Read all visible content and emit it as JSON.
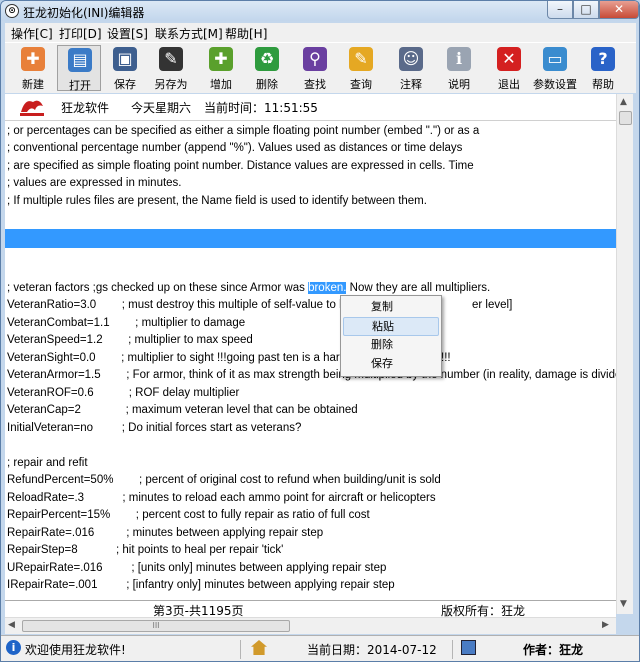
{
  "window": {
    "title": "狂龙初始化(INI)编辑器",
    "app_icon_glyph": "⊙",
    "controls": {
      "minimize": "–",
      "maximize": "□",
      "close": "✕"
    }
  },
  "menubar": {
    "items": [
      {
        "label": "操作[C]"
      },
      {
        "label": "打印[D]"
      },
      {
        "label": "设置[S]"
      },
      {
        "label": "联系方式[M]"
      },
      {
        "label": "帮助[H]"
      }
    ]
  },
  "toolbar": {
    "buttons": [
      {
        "label": "新建",
        "icon": "new-document-icon",
        "glyph": "✚",
        "color": "#e8803a"
      },
      {
        "label": "打开",
        "icon": "open-document-icon",
        "glyph": "▤",
        "color": "#3b7bc7"
      },
      {
        "label": "保存",
        "icon": "save-disk-icon",
        "glyph": "▣",
        "color": "#3e5f8f"
      },
      {
        "label": "另存为",
        "icon": "save-as-pen-icon",
        "glyph": "✎",
        "color": "#333333"
      },
      {
        "label": "增加",
        "icon": "add-icon",
        "glyph": "✚",
        "color": "#5aa02c"
      },
      {
        "label": "删除",
        "icon": "recycle-bin-icon",
        "glyph": "♻",
        "color": "#2e9b3e"
      },
      {
        "label": "查找",
        "icon": "magnifier-icon",
        "glyph": "⚲",
        "color": "#6a3fa0"
      },
      {
        "label": "查询",
        "icon": "query-icon",
        "glyph": "✎",
        "color": "#e5a823"
      },
      {
        "label": "注释",
        "icon": "people-icon",
        "glyph": "☺",
        "color": "#5a6a8a"
      },
      {
        "label": "说明",
        "icon": "person-info-icon",
        "glyph": "ℹ",
        "color": "#9aa4b2"
      },
      {
        "label": "退出",
        "icon": "exit-x-icon",
        "glyph": "✕",
        "color": "#d42020"
      },
      {
        "label": "参数设置",
        "icon": "monitor-settings-icon",
        "glyph": "▭",
        "color": "#3a8ccf"
      },
      {
        "label": "帮助",
        "icon": "help-question-icon",
        "glyph": "?",
        "color": "#2a63c8"
      }
    ]
  },
  "infobar": {
    "company": "狂龙软件",
    "weekday": "今天星期六",
    "time_label": "当前时间：11:51:55"
  },
  "editor": {
    "lines": [
      "; or percentages can be specified as either a simple floating point number (embed \".\") or as a",
      "; conventional percentage number (append \"%\"). Values used as distances or time delays",
      "; are specified as simple floating point number. Distance values are expressed in cells. Time",
      "; values are expressed in minutes.",
      "; If multiple rules files are present, the Name field is used to identify between them.",
      "",
      "",
      "",
      "",
      "; veteran factors ;gs checked up on these since Armor was ",
      "VeteranRatio=3.0        ; must destroy this multiple of self-value to b",
      "VeteranCombat=1.1        ; multiplier to damage",
      "VeteranSpeed=1.2        ; multiplier to max speed",
      "VeteranSight=0.0        ; multiplier to sight !!!going past ten is a har",
      "VeteranArmor=1.5        ; For armor, think of it as max strength being multiplied by the number (in reality, damage is divide",
      "VeteranROF=0.6           ; ROF delay multiplier",
      "VeteranCap=2              ; maximum veteran level that can be obtained",
      "InitialVeteran=no         ; Do initial forces start as veterans?",
      "",
      "; repair and refit",
      "RefundPercent=50%        ; percent of original cost to refund when building/unit is sold",
      "ReloadRate=.3            ; minutes to reload each ammo point for aircraft or helicopters",
      "RepairPercent=15%        ; percent cost to fully repair as ratio of full cost",
      "RepairRate=.016          ; minutes between applying repair step",
      "RepairStep=8            ; hit points to heal per repair 'tick'",
      "URepairRate=.016         ; [units only] minutes between applying repair step",
      "IRepairRate=.001         ; [infantry only] minutes between applying repair step"
    ],
    "selected_word": "broken.",
    "after_selection": " Now they are all multipliers.",
    "line10_tail": "er level]",
    "line13_tail": "!!!"
  },
  "context_menu": {
    "items": [
      {
        "label": "复制"
      },
      {
        "label": "粘贴"
      },
      {
        "label": "删除"
      },
      {
        "label": "保存"
      }
    ],
    "hovered_index": 1
  },
  "pagebar": {
    "page_info": "第3页-共1195页",
    "copyright": "版权所有：狂龙"
  },
  "hscroll": {
    "thumb_grip": "III"
  },
  "statusbar": {
    "welcome": "欢迎使用狂龙软件!",
    "date": "当前日期：2014-07-12",
    "author": "作者：狂龙"
  }
}
